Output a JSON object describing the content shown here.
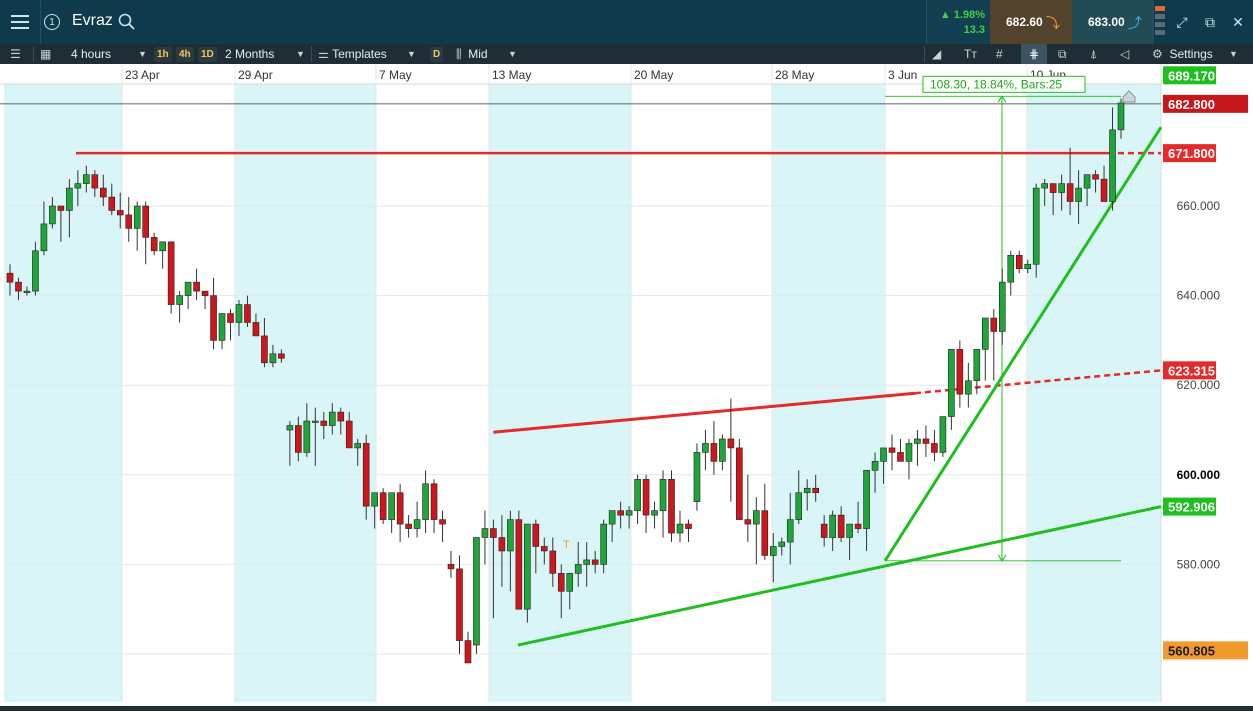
{
  "header": {
    "instrument": "Evraz",
    "info_badge": "1",
    "menu_icon": "hamburger-icon",
    "search_icon": "search-icon",
    "change_pct": "1.98%",
    "change_abs": "13.3",
    "sell_price": "682.60",
    "buy_price": "683.00",
    "up_color": "#3fd13f",
    "window_icons": [
      "expand-icon",
      "popout-icon",
      "close-icon"
    ]
  },
  "toolbar": {
    "interval": "4 hours",
    "quick_timeframes": [
      "1h",
      "4h",
      "1D"
    ],
    "range": "2 Months",
    "templates": "Templates",
    "d_badge": "D",
    "price_type": "Mid",
    "settings": "Settings"
  },
  "chart_data": {
    "type": "candlestick",
    "title": "",
    "x_tick_labels": [
      "23 Apr",
      "29 Apr",
      "7 May",
      "13 May",
      "20 May",
      "28 May",
      "3 Jun",
      "10 Jun"
    ],
    "y_tick_labels": [
      "660.000",
      "640.000",
      "620.000",
      "600.000",
      "580.000",
      "560.000"
    ],
    "y_tick_values": [
      660,
      640,
      620,
      600,
      580,
      560
    ],
    "ylim": [
      548,
      698
    ],
    "current_price": 682.8,
    "price_tags": [
      {
        "label": "689.170",
        "value": 689.17,
        "color": "#1fbf1f"
      },
      {
        "label": "682.800",
        "value": 682.8,
        "color": "#c8161d"
      },
      {
        "label": "671.800",
        "value": 671.8,
        "color": "#e52a2a"
      },
      {
        "label": "623.315",
        "value": 623.315,
        "color": "#e52a2a"
      },
      {
        "label": "592.906",
        "value": 592.906,
        "color": "#1fbf1f"
      },
      {
        "label": "560.805",
        "value": 560.805,
        "color": "#f29a2e"
      }
    ],
    "measure_label": "108.30, 18.84%, Bars:25",
    "measure_start": 580.8,
    "measure_end": 689.17,
    "annotations": [
      "T"
    ],
    "up_color": "#1fa63a",
    "down_color": "#d0161d",
    "candles": [
      [
        645,
        647,
        640,
        643
      ],
      [
        643,
        644,
        639,
        641
      ],
      [
        641,
        642,
        640,
        641
      ],
      [
        641,
        652,
        640,
        650
      ],
      [
        650,
        661,
        649,
        656
      ],
      [
        656,
        662,
        655,
        660
      ],
      [
        660,
        660,
        652,
        659
      ],
      [
        659,
        666,
        653,
        664
      ],
      [
        664,
        668,
        660,
        665
      ],
      [
        665,
        669,
        663,
        667
      ],
      [
        667,
        668,
        662,
        664
      ],
      [
        664,
        667,
        660,
        662
      ],
      [
        662,
        665,
        658,
        659
      ],
      [
        659,
        663,
        655,
        658
      ],
      [
        658,
        662,
        652,
        655
      ],
      [
        655,
        661,
        650,
        660
      ],
      [
        660,
        661,
        647,
        653
      ],
      [
        653,
        654,
        649,
        650
      ],
      [
        650,
        652,
        646,
        652
      ],
      [
        652,
        652,
        636,
        638
      ],
      [
        638,
        641,
        634,
        640
      ],
      [
        640,
        643,
        637,
        643
      ],
      [
        643,
        646,
        639,
        641
      ],
      [
        641,
        641,
        637,
        640
      ],
      [
        640,
        644,
        628,
        630
      ],
      [
        630,
        636,
        628,
        636
      ],
      [
        636,
        637,
        630,
        634
      ],
      [
        634,
        639,
        631,
        638
      ],
      [
        638,
        640,
        633,
        634
      ],
      [
        634,
        636,
        632,
        631
      ],
      [
        631,
        635,
        624,
        625
      ],
      [
        625,
        629,
        624,
        627
      ],
      [
        627,
        628,
        625,
        626
      ],
      [
        610,
        612,
        602,
        611
      ],
      [
        611,
        613,
        603,
        605
      ],
      [
        605,
        616,
        604,
        612
      ],
      [
        612,
        615,
        602,
        612
      ],
      [
        612,
        614,
        608,
        611
      ],
      [
        611,
        616,
        609,
        614
      ],
      [
        614,
        615,
        609,
        612
      ],
      [
        612,
        614,
        606,
        606
      ],
      [
        606,
        608,
        602,
        607
      ],
      [
        607,
        609,
        590,
        593
      ],
      [
        593,
        595,
        588,
        596
      ],
      [
        596,
        597,
        589,
        590
      ],
      [
        590,
        596,
        587,
        596
      ],
      [
        596,
        598,
        585,
        589
      ],
      [
        589,
        591,
        586,
        588
      ],
      [
        588,
        594,
        586,
        590
      ],
      [
        590,
        601,
        587,
        598
      ],
      [
        598,
        599,
        587,
        590
      ],
      [
        590,
        592,
        585,
        589
      ],
      [
        580,
        583,
        577,
        579
      ],
      [
        579,
        582,
        560,
        563
      ],
      [
        563,
        565,
        559,
        558
      ],
      [
        562,
        578,
        560,
        586
      ],
      [
        586,
        592,
        580,
        588
      ],
      [
        588,
        590,
        568,
        586
      ],
      [
        586,
        591,
        575,
        583
      ],
      [
        583,
        592,
        574,
        590
      ],
      [
        590,
        592,
        578,
        570
      ],
      [
        570,
        588,
        567,
        589
      ],
      [
        589,
        590,
        578,
        584
      ],
      [
        584,
        586,
        580,
        583
      ],
      [
        583,
        586,
        575,
        578
      ],
      [
        578,
        580,
        568,
        574
      ],
      [
        574,
        578,
        570,
        578
      ],
      [
        578,
        585,
        575,
        580
      ],
      [
        580,
        585,
        575,
        581
      ],
      [
        581,
        583,
        578,
        580
      ],
      [
        580,
        590,
        578,
        589
      ],
      [
        589,
        592,
        585,
        592
      ],
      [
        592,
        594,
        588,
        591
      ],
      [
        591,
        593,
        588,
        592
      ],
      [
        592,
        600,
        589,
        599
      ],
      [
        599,
        600,
        587,
        591
      ],
      [
        591,
        594,
        588,
        592
      ],
      [
        592,
        601,
        586,
        599
      ],
      [
        599,
        601,
        585,
        587
      ],
      [
        587,
        592,
        585,
        589
      ],
      [
        589,
        590,
        585,
        588
      ],
      [
        594,
        607,
        592,
        605
      ],
      [
        605,
        610,
        601,
        607
      ],
      [
        607,
        612,
        600,
        603
      ],
      [
        603,
        609,
        601,
        608
      ],
      [
        608,
        617,
        594,
        606
      ],
      [
        606,
        608,
        594,
        590
      ],
      [
        590,
        600,
        585,
        589
      ],
      [
        589,
        595,
        580,
        592
      ],
      [
        592,
        598,
        581,
        582
      ],
      [
        582,
        587,
        576,
        584
      ],
      [
        584,
        586,
        582,
        585
      ],
      [
        585,
        596,
        580,
        590
      ],
      [
        590,
        601,
        589,
        596
      ],
      [
        596,
        599,
        592,
        597
      ],
      [
        597,
        600,
        594,
        596
      ],
      [
        589,
        591,
        584,
        586
      ],
      [
        586,
        592,
        583,
        591
      ],
      [
        591,
        593,
        585,
        586
      ],
      [
        586,
        589,
        581,
        589
      ],
      [
        589,
        594,
        587,
        588
      ],
      [
        588,
        598,
        583,
        601
      ],
      [
        601,
        605,
        596,
        603
      ],
      [
        603,
        606,
        598,
        606
      ],
      [
        606,
        609,
        601,
        605
      ],
      [
        605,
        608,
        603,
        603
      ],
      [
        603,
        608,
        599,
        607
      ],
      [
        607,
        610,
        602,
        608
      ],
      [
        608,
        611,
        604,
        607
      ],
      [
        607,
        610,
        603,
        605
      ],
      [
        605,
        613,
        604,
        613
      ],
      [
        613,
        628,
        610,
        628
      ],
      [
        628,
        630,
        615,
        618
      ],
      [
        618,
        625,
        615,
        621
      ],
      [
        621,
        628,
        618,
        628
      ],
      [
        628,
        634,
        621,
        635
      ],
      [
        635,
        637,
        621,
        632
      ],
      [
        632,
        646,
        629,
        643
      ],
      [
        643,
        650,
        640,
        649
      ],
      [
        649,
        650,
        645,
        646
      ],
      [
        646,
        648,
        645,
        647
      ],
      [
        647,
        665,
        644,
        664
      ],
      [
        664,
        666,
        660,
        665
      ],
      [
        665,
        665,
        658,
        663
      ],
      [
        663,
        667,
        659,
        665
      ],
      [
        665,
        673,
        658,
        661
      ],
      [
        661,
        668,
        656,
        664
      ],
      [
        664,
        667,
        660,
        667
      ],
      [
        667,
        668,
        663,
        666
      ],
      [
        666,
        669,
        661,
        661
      ],
      [
        661,
        682,
        659,
        677
      ],
      [
        677,
        684,
        675,
        683
      ]
    ],
    "drawings": {
      "red_resistance_level": 671.8,
      "red_trendline": {
        "from": [
          57,
          609.5
        ],
        "to": [
          149,
          623.3
        ]
      },
      "green_trendline_lower": {
        "from": [
          72,
          562.0
        ],
        "to": [
          149,
          592.9
        ]
      },
      "green_trendline_steep": {
        "from": [
          121,
          580.8
        ],
        "to": [
          149,
          689.2
        ]
      }
    }
  }
}
